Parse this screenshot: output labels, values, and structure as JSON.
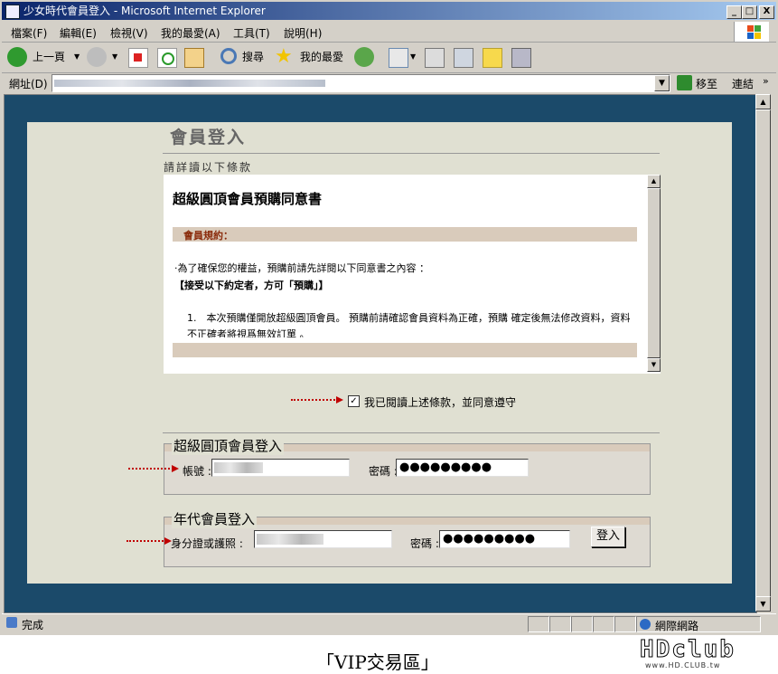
{
  "window": {
    "title": "少女時代會員登入 - Microsoft Internet Explorer",
    "minimize": "_",
    "maximize": "□",
    "close": "X"
  },
  "menu": [
    "檔案(F)",
    "編輯(E)",
    "檢視(V)",
    "我的最愛(A)",
    "工具(T)",
    "說明(H)"
  ],
  "toolbar": {
    "back": "上一頁",
    "search": "搜尋",
    "favorites": "我的最愛"
  },
  "address": {
    "label": "網址(D)",
    "go": "移至",
    "links": "連結"
  },
  "page": {
    "title": "會員登入",
    "subtitle": "請詳讀以下條款",
    "terms": {
      "heading": "超級圓頂會員預購同意書",
      "section": "會員規約：",
      "intro": "‧為了確保您的權益，預購前請先詳閱以下同意書之內容 ：",
      "notice": "【接受以下約定者，方可「預購」】",
      "item1": "1.　本次預購僅開放超級圓頂會員。 預購前請確認會員資料為正確，預購 確定後無法修改資料，資料不正確者將視爲無效訂單 。"
    },
    "agree": "我已閱讀上述條款，並同意遵守",
    "agree_checked": true,
    "login1": {
      "legend": "超級圓頂會員登入",
      "account_label": "帳號 :",
      "password_label": "密碼 :",
      "password_value": "●●●●●●●●●"
    },
    "login2": {
      "legend": "年代會員登入",
      "id_label": "身分證或護照 :",
      "password_label": "密碼 :",
      "password_value": "●●●●●●●●●",
      "submit": "登入"
    }
  },
  "status": {
    "text": "完成",
    "zone": "網際網路"
  },
  "caption": "「VIP交易區」",
  "watermark": {
    "logo": "HDclub",
    "url": "www.HD.CLUB.tw"
  }
}
